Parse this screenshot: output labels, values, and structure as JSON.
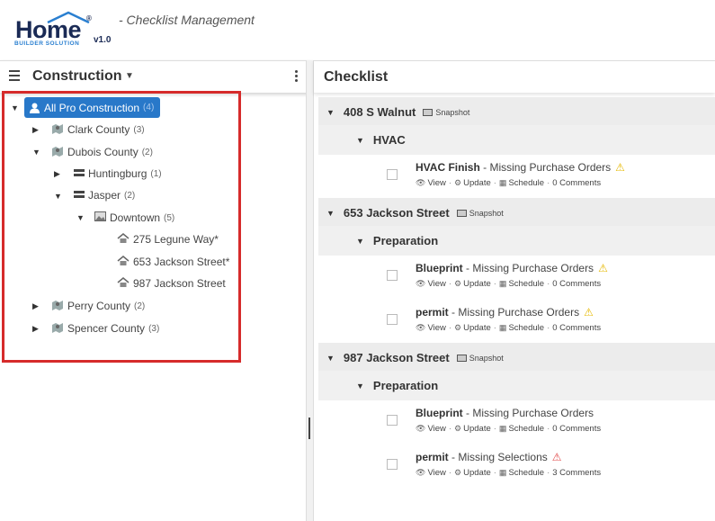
{
  "app": {
    "logo_main": "Home",
    "logo_sub": "BUILDER SOLUTION",
    "logo_reg": "®",
    "version": "v1.0",
    "title": "- Checklist Management"
  },
  "left": {
    "org_name": "Construction",
    "root": {
      "label": "All Pro Construction",
      "count": "(4)"
    },
    "nodes": [
      {
        "label": "Clark County",
        "count": "(3)"
      },
      {
        "label": "Dubois County",
        "count": "(2)"
      },
      {
        "label": "Huntingburg",
        "count": "(1)"
      },
      {
        "label": "Jasper",
        "count": "(2)"
      },
      {
        "label": "Downtown",
        "count": "(5)"
      },
      {
        "label": "275 Legune Way*",
        "count": ""
      },
      {
        "label": "653 Jackson Street*",
        "count": ""
      },
      {
        "label": "987 Jackson Street",
        "count": ""
      },
      {
        "label": "Perry County",
        "count": "(2)"
      },
      {
        "label": "Spencer County",
        "count": "(3)"
      }
    ]
  },
  "right": {
    "title": "Checklist",
    "snapshot_label": "Snapshot",
    "links": {
      "view": "View",
      "update": "Update",
      "schedule": "Schedule"
    },
    "sites": [
      {
        "name": "408 S Walnut",
        "category": "HVAC",
        "items": [
          {
            "name": "HVAC Finish",
            "status": "- Missing Purchase Orders",
            "comments": "0 Comments",
            "warn": "yellow"
          }
        ]
      },
      {
        "name": "653 Jackson Street",
        "category": "Preparation",
        "items": [
          {
            "name": "Blueprint",
            "status": "- Missing Purchase Orders",
            "comments": "0 Comments",
            "warn": "yellow"
          },
          {
            "name": "permit",
            "status": "- Missing Purchase Orders",
            "comments": "0 Comments",
            "warn": "yellow"
          }
        ]
      },
      {
        "name": "987 Jackson Street",
        "category": "Preparation",
        "items": [
          {
            "name": "Blueprint",
            "status": "- Missing Purchase Orders",
            "comments": "0 Comments",
            "warn": "none"
          },
          {
            "name": "permit",
            "status": "- Missing Selections",
            "comments": "3 Comments",
            "warn": "red"
          }
        ]
      }
    ]
  }
}
